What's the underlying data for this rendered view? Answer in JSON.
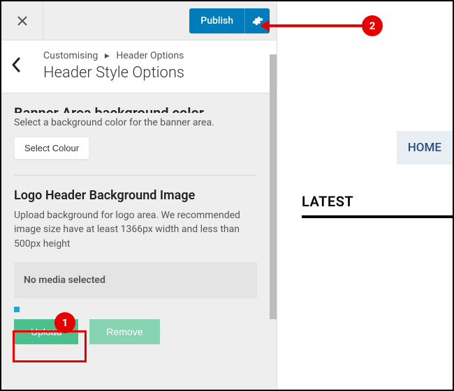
{
  "toolbar": {
    "publish_label": "Publish"
  },
  "header": {
    "breadcrumb_root": "Customising",
    "breadcrumb_parent": "Header Options",
    "title": "Header Style Options"
  },
  "section_banner": {
    "title_cut": "Banner Area background color",
    "desc": "Select a background color for the banner area.",
    "select_colour_label": "Select Colour"
  },
  "section_logo_bg": {
    "title": "Logo Header Background Image",
    "desc": "Upload background for logo area. We recommended image size have at least 1366px width and less than 500px height",
    "no_media": "No media selected",
    "upload_label": "Upload",
    "remove_label": "Remove"
  },
  "annotations": {
    "badge1": "1",
    "badge2": "2"
  },
  "preview": {
    "home_tab": "HOME",
    "latest_label": "LATEST"
  }
}
